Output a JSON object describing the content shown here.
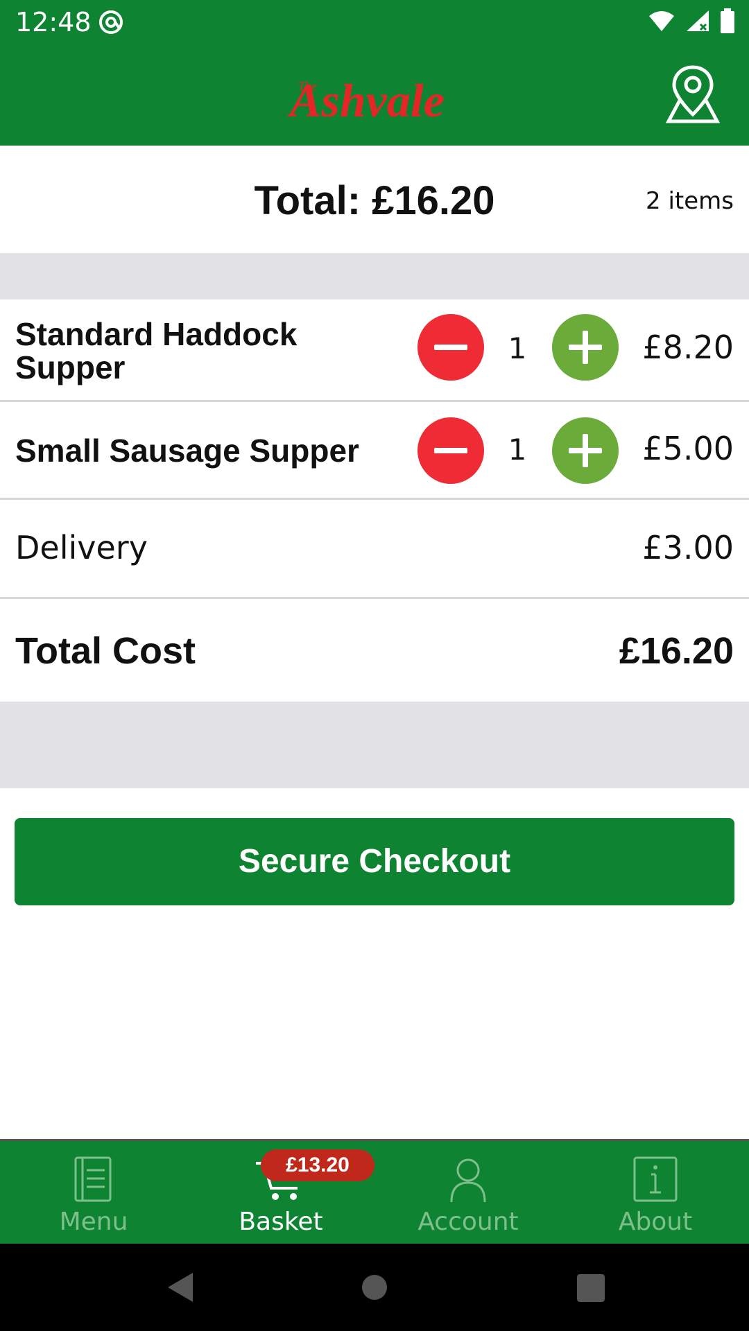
{
  "status_bar": {
    "time": "12:48"
  },
  "header": {
    "logo_text": "The Ashvale",
    "location_icon": "map-pin-icon"
  },
  "summary": {
    "total_label": "Total: £16.20",
    "item_count": "2 items"
  },
  "basket": {
    "items": [
      {
        "name": "Standard Haddock Supper",
        "quantity": "1",
        "price": "£8.20"
      },
      {
        "name": "Small Sausage Supper",
        "quantity": "1",
        "price": "£5.00"
      }
    ],
    "delivery": {
      "label": "Delivery",
      "price": "£3.00"
    },
    "total_cost": {
      "label": "Total Cost",
      "value": "£16.20"
    }
  },
  "checkout": {
    "label": "Secure Checkout"
  },
  "bottom_nav": {
    "items": [
      {
        "label": "Menu",
        "icon": "menu-icon"
      },
      {
        "label": "Basket",
        "icon": "basket-icon",
        "badge": "£13.20",
        "active": true
      },
      {
        "label": "Account",
        "icon": "account-icon"
      },
      {
        "label": "About",
        "icon": "info-icon"
      }
    ]
  },
  "colors": {
    "brand_green": "#0e8433",
    "minus_red": "#ef2b35",
    "plus_green": "#6aab3a",
    "badge_red": "#c0281c",
    "logo_red": "#e32626",
    "band_grey": "#e2e2e5"
  }
}
